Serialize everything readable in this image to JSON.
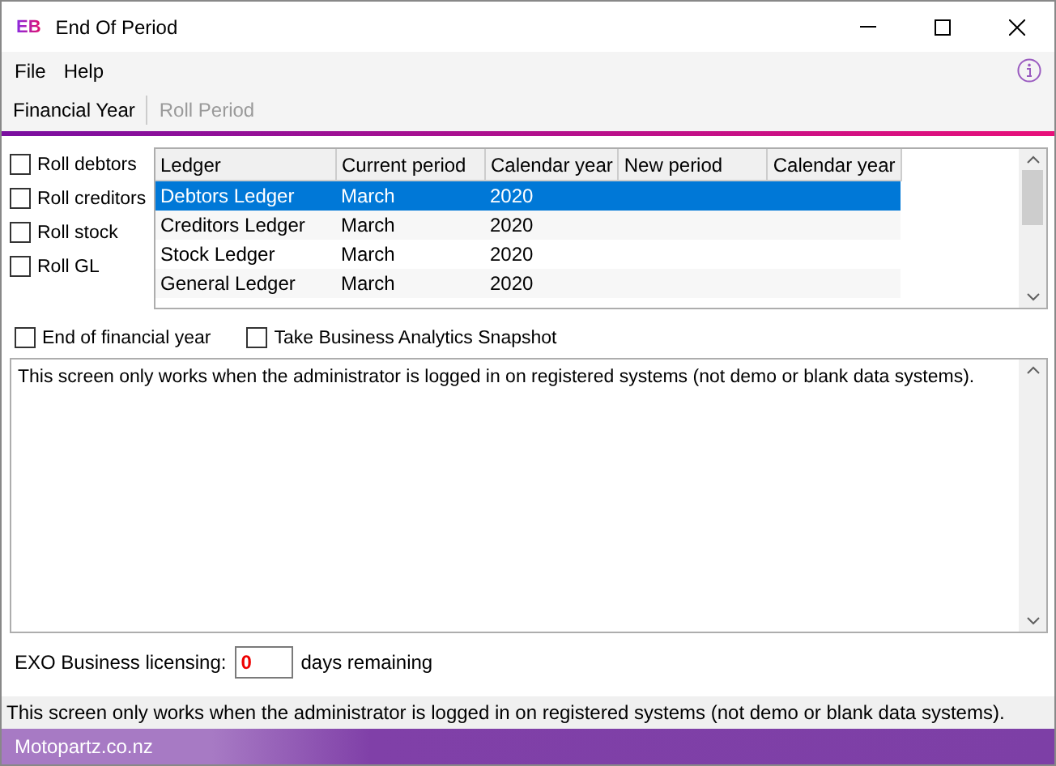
{
  "window": {
    "logo": "EB",
    "title": "End Of Period"
  },
  "menu": [
    "File",
    "Help"
  ],
  "tabs": [
    {
      "label": "Financial Year",
      "disabled": false
    },
    {
      "label": "Roll Period",
      "disabled": true
    }
  ],
  "roll_options": [
    {
      "label": "Roll debtors",
      "checked": false
    },
    {
      "label": "Roll creditors",
      "checked": false
    },
    {
      "label": "Roll stock",
      "checked": false
    },
    {
      "label": "Roll GL",
      "checked": false
    }
  ],
  "table": {
    "columns": [
      "Ledger",
      "Current period",
      "Calendar year",
      "New period",
      "Calendar year"
    ],
    "rows": [
      {
        "cells": [
          "Debtors Ledger",
          "March",
          "2020",
          "",
          ""
        ],
        "selected": true
      },
      {
        "cells": [
          "Creditors Ledger",
          "March",
          "2020",
          "",
          ""
        ],
        "selected": false
      },
      {
        "cells": [
          "Stock Ledger",
          "March",
          "2020",
          "",
          ""
        ],
        "selected": false
      },
      {
        "cells": [
          "General Ledger",
          "March",
          "2020",
          "",
          ""
        ],
        "selected": false
      }
    ]
  },
  "options": [
    {
      "label": "End of financial year",
      "checked": false
    },
    {
      "label": "Take Business Analytics Snapshot",
      "checked": false
    }
  ],
  "message": "This screen only works when the administrator is logged in on registered systems (not demo or blank data systems).",
  "licensing": {
    "label": "EXO Business licensing:",
    "value": "0",
    "suffix": "days remaining"
  },
  "status_bar": "This screen only works when the administrator is logged in on registered systems (not demo or blank data systems).",
  "footer": "Motopartz.co.nz"
}
